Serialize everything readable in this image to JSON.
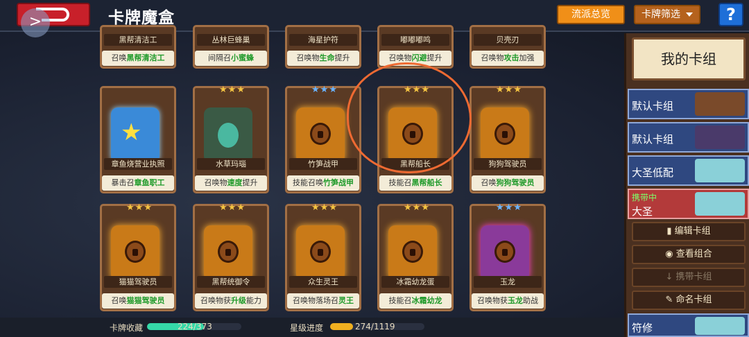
{
  "header": {
    "title": "卡牌魔盒",
    "style_button": "流派总览",
    "filter_button": "卡牌筛选",
    "help": "?",
    "side_tab": ">"
  },
  "cards_top": [
    {
      "name": "黑帮清洁工",
      "desc_pre": "召唤",
      "desc_hl": "黑帮清洁工",
      "desc_post": ""
    },
    {
      "name": "丛林巨蜂巢",
      "desc_pre": "间隔召",
      "desc_hl": "小蜜蜂",
      "desc_post": ""
    },
    {
      "name": "海星护符",
      "desc_pre": "召唤物",
      "desc_hl": "生命",
      "desc_post": "提升"
    },
    {
      "name": "嘟嘟嘟鸣",
      "desc_pre": "召唤物",
      "desc_hl": "闪避",
      "desc_post": "提升"
    },
    {
      "name": "贝壳刃",
      "desc_pre": "召唤物",
      "desc_hl": "攻击",
      "desc_post": "加强"
    }
  ],
  "cards_mid": [
    {
      "name": "章鱼烧营业执照",
      "desc_pre": "暴击召",
      "desc_hl": "章鱼职工",
      "desc_post": ""
    },
    {
      "name": "水草玛瑙",
      "desc_pre": "召唤物",
      "desc_hl": "速度",
      "desc_post": "提升"
    },
    {
      "name": "竹笋战甲",
      "desc_pre": "技能召唤",
      "desc_hl": "竹笋战甲",
      "desc_post": ""
    },
    {
      "name": "黑帮船长",
      "desc_pre": "技能召",
      "desc_hl": "黑帮船长",
      "desc_post": ""
    },
    {
      "name": "狗狗驾驶员",
      "desc_pre": "召唤",
      "desc_hl": "狗狗驾驶员",
      "desc_post": ""
    }
  ],
  "cards_bot": [
    {
      "name": "猫猫驾驶员",
      "desc_pre": "召唤",
      "desc_hl": "猫猫驾驶员",
      "desc_post": ""
    },
    {
      "name": "黑帮统御令",
      "desc_pre": "召唤物获",
      "desc_hl": "升级",
      "desc_post": "能力"
    },
    {
      "name": "众生灵王",
      "desc_pre": "召唤物落场召",
      "desc_hl": "灵王",
      "desc_post": ""
    },
    {
      "name": "冰霜幼龙蛋",
      "desc_pre": "技能召",
      "desc_hl": "冰霜幼龙",
      "desc_post": ""
    },
    {
      "name": "玉龙",
      "desc_pre": "召唤物获",
      "desc_hl": "玉龙",
      "desc_post": "助战"
    }
  ],
  "panel": {
    "title": "我的卡组",
    "decks": [
      "默认卡组",
      "默认卡组",
      "大圣低配"
    ],
    "carry_tag": "携带中",
    "carry_name": "大圣",
    "buttons": [
      "编辑卡组",
      "查看组合",
      "携带卡组",
      "命名卡组"
    ],
    "last_deck": "符修"
  },
  "bottom": {
    "collection_label": "卡牌收藏",
    "collection_value": "224/373",
    "collection_fraction": 0.6005,
    "star_label": "星级进度",
    "star_value": "274/1119",
    "star_fraction": 0.2449
  },
  "colors": {
    "accent_orange": "#f08f18",
    "help_blue": "#1e6fd8",
    "highlight_green": "#1f9a2a",
    "circle": "#ee6a32"
  }
}
